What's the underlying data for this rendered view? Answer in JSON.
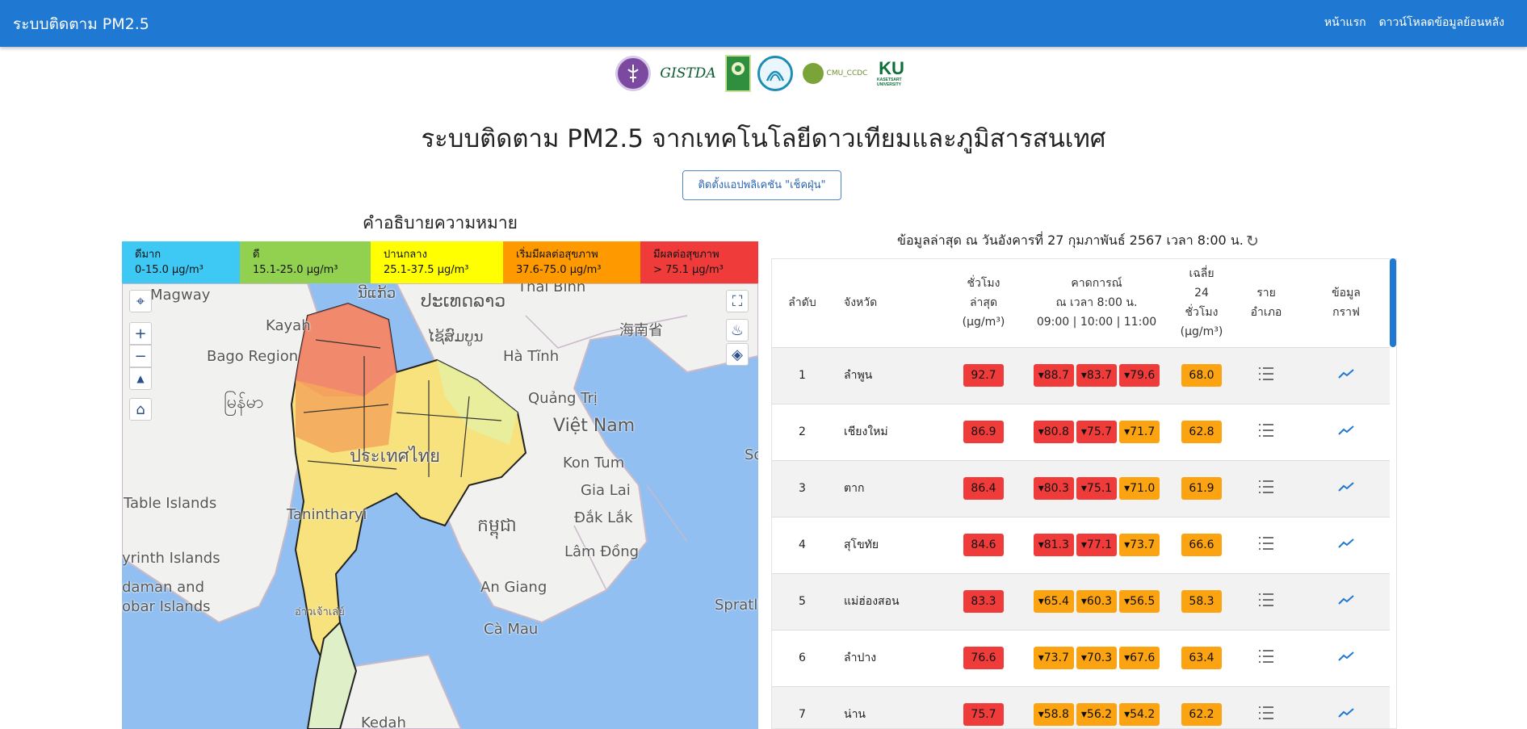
{
  "navbar": {
    "brand": "ระบบติดตาม PM2.5",
    "links": [
      "หน้าแรก",
      "ดาวน์โหลดข้อมูลย้อนหลัง"
    ]
  },
  "logos": {
    "gistda": "GISTDA",
    "nrct": "วช. NRCT",
    "cmu": "CMU_CCDC",
    "ku": "KU",
    "ku_sub": "KASETSART UNIVERSITY"
  },
  "page": {
    "title": "ระบบติดตาม PM2.5 จากเทคโนโลยีดาวเทียมและภูมิสารสนเทศ",
    "install_button": "ติดตั้งแอปพลิเคชัน \"เช็คฝุ่น\""
  },
  "legend": {
    "title": "คำอธิบายความหมาย",
    "items": [
      {
        "label": "ดีมาก",
        "range": "0-15.0 µg/m³",
        "color": "#3ec9f5"
      },
      {
        "label": "ดี",
        "range": "15.1-25.0 µg/m³",
        "color": "#92d050"
      },
      {
        "label": "ปานกลาง",
        "range": "25.1-37.5 µg/m³",
        "color": "#ffff00"
      },
      {
        "label": "เริ่มมีผลต่อสุขภาพ",
        "range": "37.6-75.0 µg/m³",
        "color": "#ff9900"
      },
      {
        "label": "มีผลต่อสุขภาพ",
        "range": "> 75.1 µg/m³",
        "color": "#f03b3b"
      }
    ]
  },
  "map": {
    "labels": [
      "Magway",
      "Kayah",
      "Bago Region",
      "မြန်မာ",
      "Table Islands",
      "yrinth Islands",
      "daman and",
      "obar Islands",
      "Tanintharyi",
      "อ่าวเจ้าเล่ย์",
      "Kedah",
      "ນີແກ້ວ",
      "ປະເທດລາວ",
      "ໄຊ້ສົມບູນ",
      "Thai Bình",
      "海南省",
      "Hà Tĩnh",
      "Quảng Trị",
      "Việt Nam",
      "ประเทศไทย",
      "Kon Tum",
      "Gia Lai",
      "Đắk Lắk",
      "កម្ពុជា",
      "Lâm Đồng",
      "An Giang",
      "Cà Mau",
      "Spratly",
      "So"
    ]
  },
  "table": {
    "updated": "ข้อมูลล่าสุด ณ วันอังคารที่ 27 กุมภาพันธ์ 2567 เวลา 8:00 น.",
    "headers": {
      "rank": "ลำดับ",
      "province": "จังหวัด",
      "latest_1": "ชั่วโมง",
      "latest_2": "ล่าสุด",
      "latest_3": "(µg/m³)",
      "forecast_1": "คาดการณ์",
      "forecast_2": "ณ เวลา 8:00 น.",
      "forecast_3": "09:00 | 10:00 | 11:00",
      "avg_1": "เฉลี่ย",
      "avg_2": "24",
      "avg_3": "ชั่วโมง",
      "avg_4": "(µg/m³)",
      "district_1": "ราย",
      "district_2": "อำเภอ",
      "graph_1": "ข้อมูล",
      "graph_2": "กราฟ"
    },
    "rows": [
      {
        "rank": "1",
        "province": "ลำพูน",
        "latest": "92.7",
        "f1": "▾88.7",
        "f2": "▾83.7",
        "f3": "▾79.6",
        "avg": "68.0"
      },
      {
        "rank": "2",
        "province": "เชียงใหม่",
        "latest": "86.9",
        "f1": "▾80.8",
        "f2": "▾75.7",
        "f3": "▾71.7",
        "avg": "62.8"
      },
      {
        "rank": "3",
        "province": "ตาก",
        "latest": "86.4",
        "f1": "▾80.3",
        "f2": "▾75.1",
        "f3": "▾71.0",
        "avg": "61.9"
      },
      {
        "rank": "4",
        "province": "สุโขทัย",
        "latest": "84.6",
        "f1": "▾81.3",
        "f2": "▾77.1",
        "f3": "▾73.7",
        "avg": "66.6"
      },
      {
        "rank": "5",
        "province": "แม่ฮ่องสอน",
        "latest": "83.3",
        "f1": "▾65.4",
        "f2": "▾60.3",
        "f3": "▾56.5",
        "avg": "58.3"
      },
      {
        "rank": "6",
        "province": "ลำปาง",
        "latest": "76.6",
        "f1": "▾73.7",
        "f2": "▾70.3",
        "f3": "▾67.6",
        "avg": "63.4"
      },
      {
        "rank": "7",
        "province": "น่าน",
        "latest": "75.7",
        "f1": "▾58.8",
        "f2": "▾56.2",
        "f3": "▾54.2",
        "avg": "62.2"
      }
    ]
  }
}
